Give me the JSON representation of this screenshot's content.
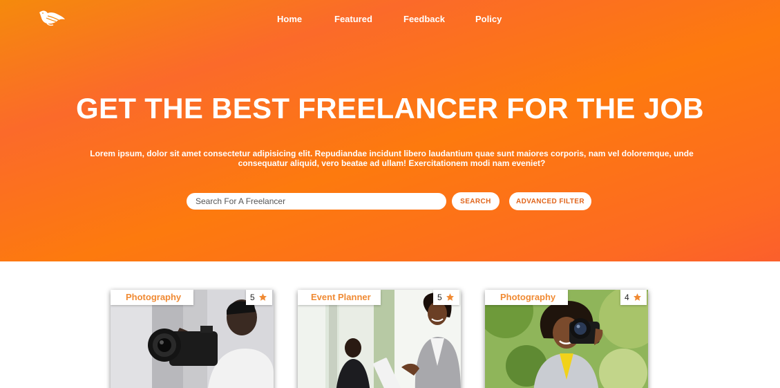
{
  "colors": {
    "accent": "#f58a0c",
    "accent_deep": "#fb6a2a",
    "tag_text": "#f08a33",
    "button_text": "#e0651c"
  },
  "header": {
    "logo_icon": "bird-logo-icon",
    "nav": [
      "Home",
      "Featured",
      "Feedback",
      "Policy"
    ]
  },
  "hero": {
    "title": "GET THE BEST FREELANCER FOR THE JOB",
    "description": "Lorem ipsum, dolor sit amet consectetur adipisicing elit. Repudiandae incidunt libero laudantium quae sunt maiores corporis, nam vel doloremque, unde consequatur aliquid, vero beatae ad ullam! Exercitationem modi nam eveniet?"
  },
  "search": {
    "placeholder": "Search For A Freelancer",
    "search_label": "SEARCH",
    "filter_label": "ADVANCED FILTER"
  },
  "cards": [
    {
      "category": "Photography",
      "rating": "5",
      "rating_icon": "star-icon",
      "image": "man-holding-camera-photo"
    },
    {
      "category": "Event Planner",
      "rating": "5",
      "rating_icon": "star-icon",
      "image": "businesswoman-with-folder-photo"
    },
    {
      "category": "Photography",
      "rating": "4",
      "rating_icon": "star-icon",
      "image": "woman-taking-photo-outdoors"
    }
  ]
}
